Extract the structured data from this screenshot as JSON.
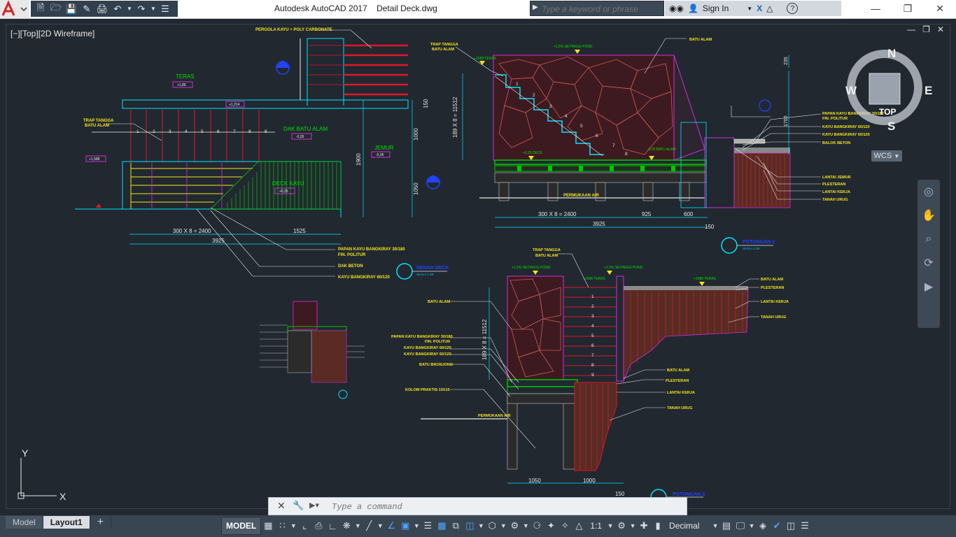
{
  "app": {
    "title": "Autodesk AutoCAD 2017    Detail Deck.dwg",
    "search_placeholder": "Type a keyword or phrase",
    "sign_in": "Sign In",
    "help": "?"
  },
  "viewport": {
    "label": "[−][Top][2D Wireframe]"
  },
  "viewcube": {
    "north": "N",
    "south": "S",
    "east": "E",
    "west": "W",
    "face": "TOP",
    "wcs": "WCS"
  },
  "ucs": {
    "y": "Y",
    "x": "X"
  },
  "command": {
    "placeholder": "Type a command"
  },
  "tabs": [
    {
      "label": "Model"
    },
    {
      "label": "Layout1"
    },
    {
      "label": "+"
    }
  ],
  "status": {
    "model": "MODEL",
    "scale": "1:1",
    "units": "Decimal"
  },
  "drawing": {
    "plan": {
      "pergola": "PERGOLA KAYU + POLY CARBONATE",
      "teras": "TERAS",
      "teras_level": "+1,86",
      "level_1214": "+1,214",
      "trap_tangga": "TRAP TANGGA",
      "batu_alam": "BATU ALAM",
      "level_1588": "+1,588",
      "dak_batu_alam": "DAK BATU ALAM",
      "dak_level": "-0,05",
      "deck_kayu": "DECK KAYU",
      "deck_level": "+0,25",
      "jemur": "JEMUR",
      "jemur_level": "-0,05",
      "dim_1900": "1900",
      "dim_1000": "1000",
      "dim_1050": "1050",
      "dim_150": "150",
      "dim_300x8": "300 X 8 = 2400",
      "dim_1525": "1525",
      "dim_3925": "3925",
      "step_numbers": [
        "1",
        "2",
        "3",
        "4",
        "5",
        "6",
        "7",
        "8",
        "9"
      ],
      "lbl_papan": "PAPAN KAYU BANGKIRAY 30/180",
      "lbl_fin": "FIN. POLITUR",
      "lbl_dak": "DAK BETON",
      "lbl_kayu": "KAYU BANGKIRAY 60/120"
    },
    "sectionA": {
      "trap": "TRAP TANGGA",
      "batu": "BATU ALAM",
      "lvl_top": "+1,5% SETINGGI POND",
      "lvl_1588": "+1588 TERAS",
      "dim_v": "189 X 8 = 11512",
      "dim_235": "235",
      "dim_1700": "1700",
      "dim_300x8": "300 X 8 = 2400",
      "dim_925": "925",
      "dim_600": "600",
      "dim_3925": "3925",
      "dim_150": "150",
      "permukaan": "PERMUKAAN AIR",
      "batu_alam": "BATU ALAM",
      "papan": "PAPAN KAYU BANGKIRAY 30/180",
      "fin": "FIN. POLITUR",
      "kayu1": "KAYU BANGKIRAY 60/120",
      "kayu2": "KAYU BANGKIRAY 60/120",
      "balok": "BALOK BETON",
      "lantai_jemur": "LANTAI JEMUR",
      "plesteran": "PLESTERAN",
      "lantai_kerja": "LANTAI KERJA",
      "tanah_urug": "TANAH URUG",
      "potongan": "POTONGAN 2",
      "skala": "SKALA 1:30",
      "step_numbers": [
        "1",
        "2",
        "3",
        "4",
        "5",
        "6",
        "7",
        "8"
      ],
      "lvl_step": "-0,05 BATU ALAM",
      "lvl_deck": "+0,25 DECK"
    },
    "sectionB": {
      "trap": "TRAP TANGGA",
      "batu_top": "BATU ALAM",
      "lvl_top1": "+1,5% SETINGGI POND",
      "lvl_top2": "+1,5% SETINGGI POND",
      "lvl_teras": "+1588 TERAS",
      "lvl_teras2": "+1588 TERAS",
      "batu_alam": "BATU ALAM",
      "papan": "PAPAN KAYU BANGKIRAY 30/180",
      "fin": "FIN. POLITUR",
      "kayu1": "KAYU BANGKIRAY 60/120",
      "kayu2": "KAYU BANGKIRAY 60/120",
      "batu_bronjong": "BATU BRONJONG",
      "kolom": "KOLOM PRAKTIS 15X15",
      "permukaan": "PERMUKAAN AIR",
      "dim_v": "189 X 8 = 11512",
      "dim_1050": "1050",
      "dim_1000": "1000",
      "dim_150": "150",
      "r_batu": "BATU ALAM",
      "r_plesteran": "PLESTERAN",
      "r_lantai": "LANTAI KERJA",
      "r_tanah": "TANAH URUG",
      "b_batu": "BATU ALAM",
      "b_plesteran": "PLESTERAN",
      "b_lantai": "LANTAI KERJA",
      "b_tanah": "TANAH URUG",
      "potongan": "POTONGAN 3",
      "step_numbers": [
        "1",
        "2",
        "3",
        "4",
        "5",
        "6",
        "7",
        "8",
        "9"
      ]
    },
    "denah": {
      "title": "DENAH DECK",
      "skala": "SKALA 1:30"
    }
  }
}
